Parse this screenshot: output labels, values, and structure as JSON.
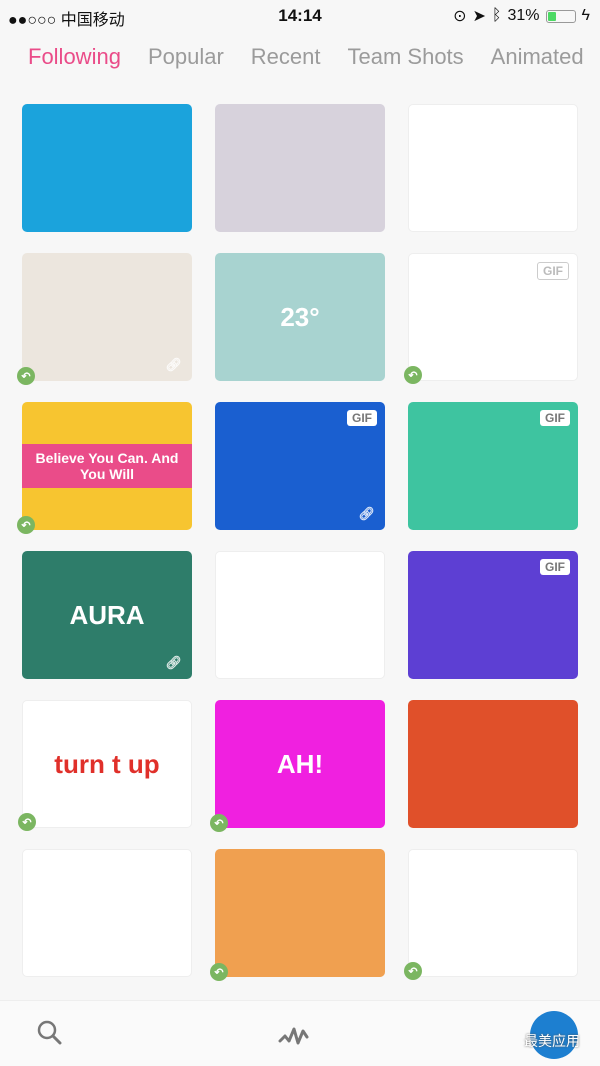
{
  "status": {
    "carrier": "●●○○○ 中国移动",
    "time": "14:14",
    "battery": "31%",
    "battery_level": 0.31
  },
  "tabs": [
    {
      "label": "Following",
      "active": true
    },
    {
      "label": "Popular"
    },
    {
      "label": "Recent"
    },
    {
      "label": "Team Shots"
    },
    {
      "label": "Animated"
    }
  ],
  "shots": [
    {
      "bg": "#1ba3dc",
      "text": ""
    },
    {
      "bg": "#d7d2dc",
      "text": ""
    },
    {
      "bg": "#ffffff",
      "text": ""
    },
    {
      "bg": "#ece6de",
      "text": "",
      "rebound": true,
      "attach": true
    },
    {
      "bg": "#a8d3d0",
      "text": "23°"
    },
    {
      "bg": "#ffffff",
      "text": "",
      "gif": "GIF",
      "gif_light": true,
      "rebound": true
    },
    {
      "bg": "#f7c530",
      "text": "Believe You Can. And You Will",
      "rebound": true
    },
    {
      "bg": "#1a5fd0",
      "text": "",
      "gif": "GIF",
      "attach": true
    },
    {
      "bg": "#3ec4a0",
      "text": "",
      "gif": "GIF"
    },
    {
      "bg": "#2e7d6a",
      "text": "AURA",
      "attach": true
    },
    {
      "bg": "#ffffff",
      "text": ""
    },
    {
      "bg": "#5d3fd3",
      "text": "",
      "gif": "GIF"
    },
    {
      "bg": "#ffffff",
      "text": "turn t up",
      "text_color": "#e0302a",
      "rebound": true
    },
    {
      "bg": "#f020e0",
      "text": "AH!",
      "rebound": true
    },
    {
      "bg": "#e0502a",
      "text": ""
    },
    {
      "bg": "#ffffff",
      "text": ""
    },
    {
      "bg": "#f0a050",
      "text": "",
      "rebound": true
    },
    {
      "bg": "#ffffff",
      "text": "",
      "rebound": true
    }
  ],
  "watermark": "最美应用",
  "colors": {
    "accent": "#ea4c89",
    "rebound": "#7bb661"
  }
}
